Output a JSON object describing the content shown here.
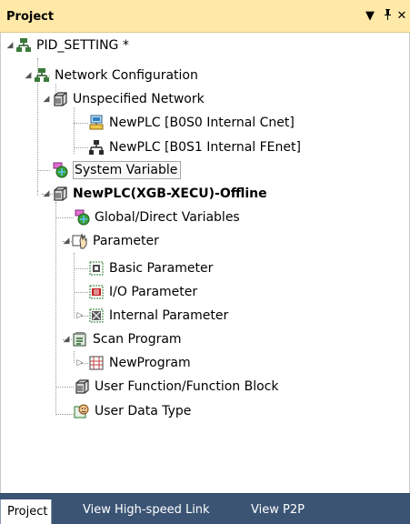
{
  "panel": {
    "title": "Project",
    "dropdown_icon": "chevron-down-icon",
    "pin_icon": "pin-icon",
    "close_icon": "close-icon"
  },
  "tree": {
    "root": "PID_SETTING *",
    "network_configuration": "Network Configuration",
    "unspecified_network": "Unspecified Network",
    "cnet": "NewPLC [B0S0 Internal Cnet]",
    "fenet": "NewPLC [B0S1 Internal FEnet]",
    "system_variable": "System Variable",
    "plc": "NewPLC(XGB-XECU)-Offline",
    "global_variables": "Global/Direct Variables",
    "parameter": "Parameter",
    "basic_parameter": "Basic Parameter",
    "io_parameter": "I/O Parameter",
    "internal_parameter": "Internal Parameter",
    "scan_program": "Scan Program",
    "new_program": "NewProgram",
    "user_function": "User Function/Function Block",
    "user_data_type": "User Data Type"
  },
  "tabs": [
    "Project",
    "View High-speed Link",
    "View P2P"
  ],
  "colors": {
    "title_bar": "#ffe9a8",
    "tab_bar": "#3b5474"
  }
}
